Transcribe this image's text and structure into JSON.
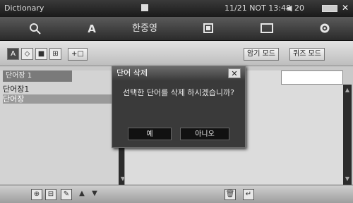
{
  "statusbar": {
    "app_title": "Dictionary",
    "time": "11/21 NOT 13:48",
    "volume": "◀ 20"
  },
  "toolbar": {
    "search_icon": "search-icon",
    "font_label": "A",
    "hanja_label": "한중영",
    "box_icon": "box-icon",
    "window_icon": "window-icon",
    "gear_icon": "gear-icon"
  },
  "modebar": {
    "mode_icons": [
      "A",
      "◇",
      "■",
      "⊞"
    ],
    "add_label": "+□",
    "memorize_mode": "암기 모드",
    "quiz_mode": "퀴즈 모드"
  },
  "word_list": {
    "header": "단어장 1",
    "items": [
      "단어장1",
      "단어장"
    ]
  },
  "bottombar": {
    "icons": [
      "⊕",
      "⊟",
      "✎",
      "▲",
      "▼",
      "🗑",
      "↵"
    ]
  },
  "dialog": {
    "title": "단어 삭제",
    "close_label": "✕",
    "message": "선택한 단어를 삭제 하시겠습니까?",
    "yes_label": "예",
    "no_label": "아니오"
  }
}
